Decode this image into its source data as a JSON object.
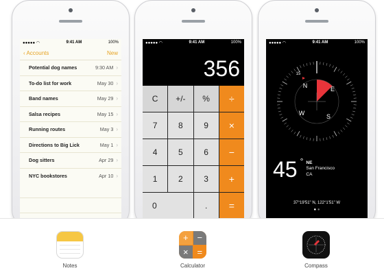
{
  "notes_screen": {
    "time": "9:41 AM",
    "battery": "100%",
    "back_label": "Accounts",
    "new_label": "New",
    "notes": [
      {
        "title": "Potential dog names",
        "date": "9:30 AM"
      },
      {
        "title": "To-do list for work",
        "date": "May 30"
      },
      {
        "title": "Band names",
        "date": "May 29"
      },
      {
        "title": "Salsa recipes",
        "date": "May 15"
      },
      {
        "title": "Running routes",
        "date": "May 3"
      },
      {
        "title": "Directions to Big Lick",
        "date": "May 1"
      },
      {
        "title": "Dog sitters",
        "date": "Apr 29"
      },
      {
        "title": "NYC bookstores",
        "date": "Apr 10"
      }
    ]
  },
  "calculator_screen": {
    "time": "9:41 AM",
    "battery": "100%",
    "display": "356",
    "keys": [
      "C",
      "+/-",
      "%",
      "÷",
      "7",
      "8",
      "9",
      "×",
      "4",
      "5",
      "6",
      "−",
      "1",
      "2",
      "3",
      "+",
      "0",
      ".",
      "="
    ]
  },
  "compass_screen": {
    "time": "9:41 AM",
    "battery": "100%",
    "heading": "45",
    "degree_symbol": "°",
    "direction": "NE",
    "city": "San Francisco",
    "region": "CA",
    "coordinates": "37°19'51\" N, 122°1'51\" W",
    "dial_marks": {
      "n": "N",
      "e": "E",
      "s": "S",
      "w": "W",
      "heading_tick": "15"
    }
  },
  "apps": [
    {
      "label": "Notes",
      "icon": "notes-app-icon"
    },
    {
      "label": "Calculator",
      "icon": "calculator-app-icon"
    },
    {
      "label": "Compass",
      "icon": "compass-app-icon"
    }
  ],
  "colors": {
    "notes_accent": "#e6a323",
    "calc_operator": "#f08a1d",
    "compass_bg": "#000000"
  }
}
